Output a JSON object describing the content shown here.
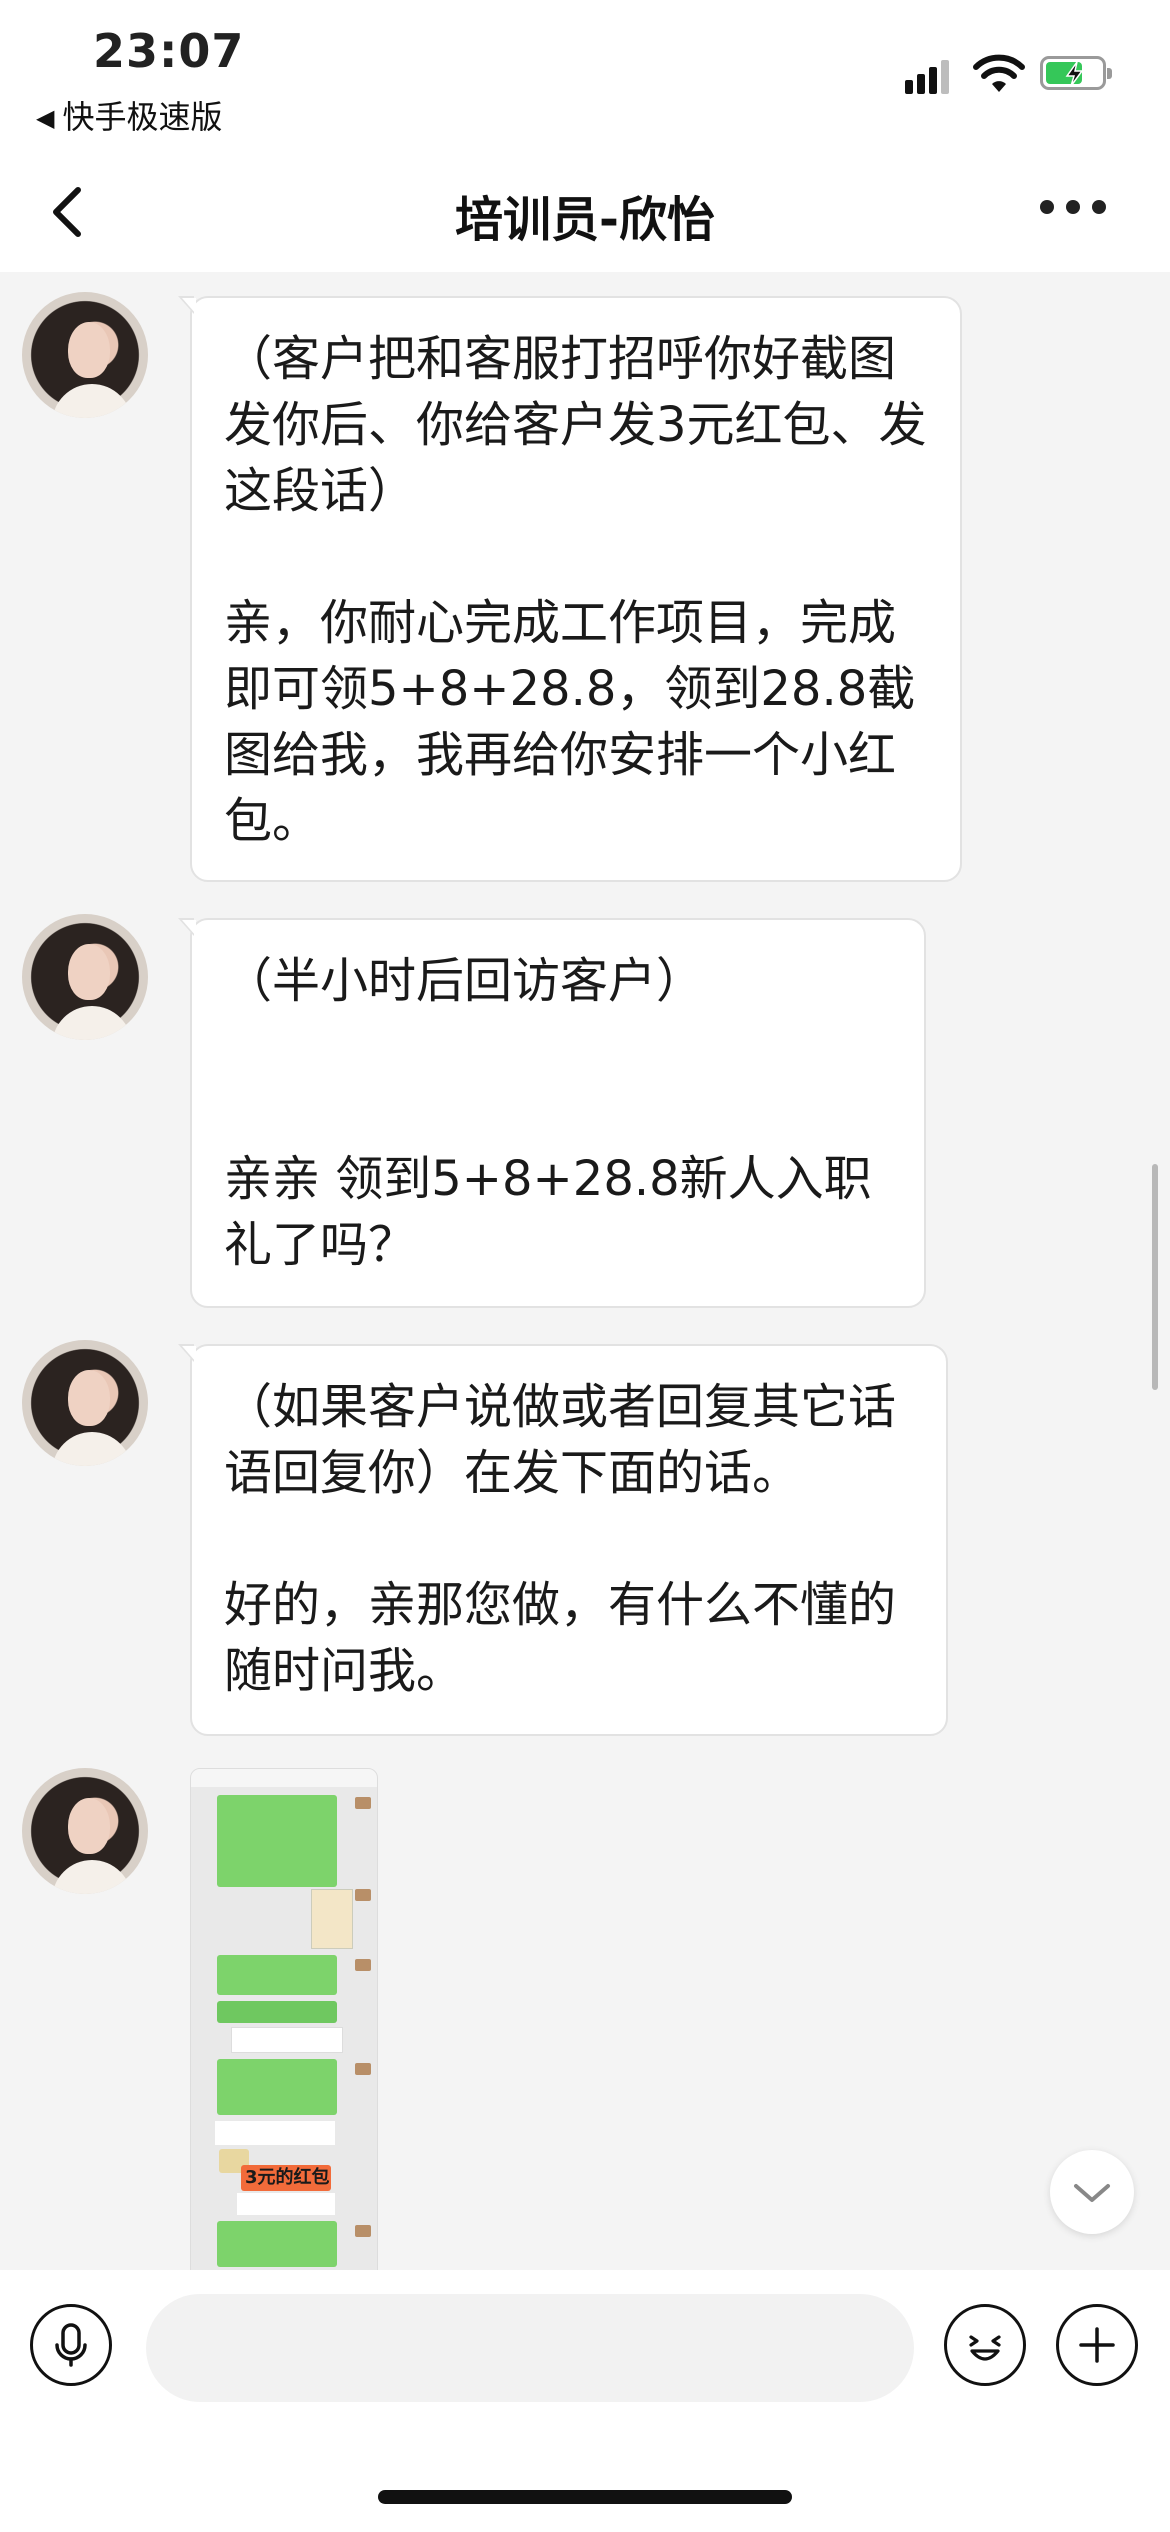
{
  "status_bar": {
    "time": "23:07",
    "back_app": "快手极速版",
    "back_arrow": "◀"
  },
  "header": {
    "title": "培训员-欣怡"
  },
  "messages": [
    {
      "type": "text",
      "text": "（客户把和客服打招呼你好截图发你后、你给客户发3元红包、发这段话）\n\n亲，你耐心完成工作项目，完成即可领5+8+28.8，领到28.8截图给我，我再给你安排一个小红包。"
    },
    {
      "type": "text",
      "text": "（半小时后回访客户）\n\n\n亲亲 领到5+8+28.8新人入职礼了吗？"
    },
    {
      "type": "text",
      "text": "（如果客户说做或者回复其它话语回复你）在发下面的话。\n\n好的，亲那您做，有什么不懂的随时问我。"
    },
    {
      "type": "image",
      "caption": "3元的红包"
    }
  ],
  "input_bar": {
    "placeholder": ""
  }
}
